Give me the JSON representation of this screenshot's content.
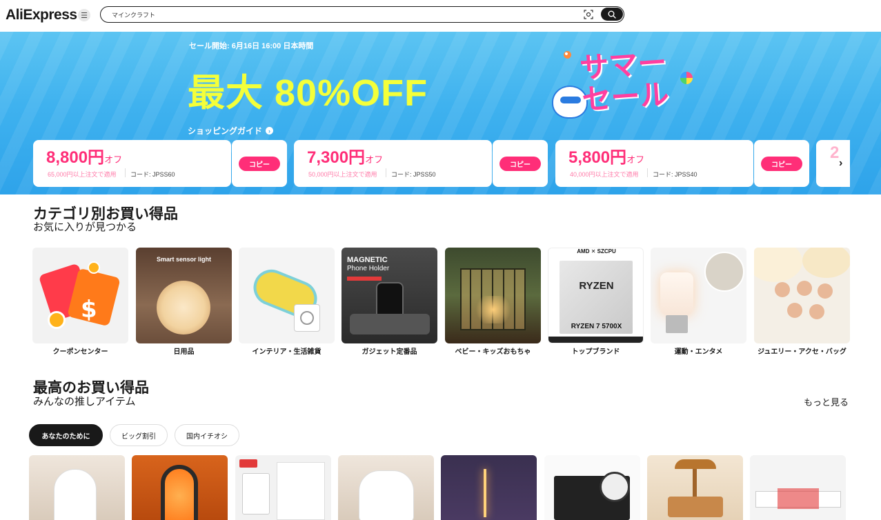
{
  "header": {
    "logo": "AliExpress",
    "search_value": "マインクラフト"
  },
  "banner": {
    "sale_start": "セール開始: 6月16日 16:00 日本時間",
    "discount": "最大 80%OFF",
    "summer_line1": "サマー",
    "summer_line2": "セール",
    "guide": "ショッピングガイド",
    "coupons": [
      {
        "amount": "8,800円",
        "unit": "オフ",
        "condition": "65,000円以上注文で適用",
        "code": "コード: JPSS60",
        "copy": "コピー"
      },
      {
        "amount": "7,300円",
        "unit": "オフ",
        "condition": "50,000円以上注文で適用",
        "code": "コード: JPSS50",
        "copy": "コピー"
      },
      {
        "amount": "5,800円",
        "unit": "オフ",
        "condition": "40,000円以上注文で適用",
        "code": "コード: JPSS40",
        "copy": "コピー"
      }
    ]
  },
  "categories": {
    "title": "カテゴリ別お買い得品",
    "subtitle": "お気に入りが見つかる",
    "items": [
      {
        "label": "クーポンセンター"
      },
      {
        "label": "日用品",
        "img_text": "Smart sensor light"
      },
      {
        "label": "インテリア・生活雑貨"
      },
      {
        "label": "ガジェット定番品",
        "img_text_1": "MAGNETIC",
        "img_text_2": "Phone Holder"
      },
      {
        "label": "ベビー・キッズおもちゃ"
      },
      {
        "label": "トップブランド",
        "img_text_1": "AMD ✕ SZCPU",
        "img_text_2": "RYZEN",
        "img_text_3": "RYZEN 7 5700X"
      },
      {
        "label": "運動・エンタメ"
      },
      {
        "label": "ジュエリー・アクセ・バッグ"
      }
    ]
  },
  "best": {
    "title": "最高のお買い得品",
    "subtitle": "みんなの推しアイテム",
    "more": "もっと見る",
    "tabs": [
      "あなたのために",
      "ビッグ割引",
      "国内イチオシ"
    ]
  },
  "colors": {
    "accent": "#ff2e78",
    "banner_blue": "#3fb2ef",
    "discount_yellow": "#f4ff3a",
    "dark": "#191919"
  }
}
